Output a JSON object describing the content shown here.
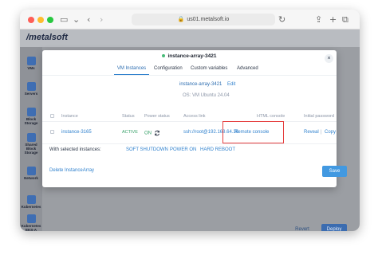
{
  "browser": {
    "url": "us01.metalsoft.io"
  },
  "app": {
    "logo": "/metalsoft",
    "sidebar": [
      "VMs",
      "Servers",
      "Block Storage",
      "Shared Block Storage",
      "Network",
      "Kubernetes",
      "Kubernetes EKS-A"
    ],
    "footer": {
      "revert_label": "Revert",
      "deploy_label": "Deploy"
    }
  },
  "modal": {
    "title": "instance-array-3421",
    "close_label": "×",
    "tabs": [
      "VM Instances",
      "Configuration",
      "Custom variables",
      "Advanced"
    ],
    "active_tab": "VM Instances",
    "array_name": "instance-array-3421",
    "edit_label": "Edit",
    "os_line": "OS: VM Ubuntu 24.04",
    "table": {
      "headers": [
        "Instance",
        "Status",
        "Power status",
        "Access link",
        "HTML console",
        "Initial password"
      ],
      "row": {
        "instance": "instance-3165",
        "status": "ACTIVE",
        "power": "ON",
        "access": "ssh://root@192.168.64.36",
        "console": "Remote console",
        "reveal": "Reveal",
        "separator": "|",
        "copy": "Copy"
      }
    },
    "bulk": {
      "label": "With selected instances:",
      "soft_shutdown": "SOFT SHUTDOWN",
      "power_on": "POWER ON",
      "hard_reboot": "HARD REBOOT"
    },
    "delete_label": "Delete InstanceArray",
    "save_label": "Save"
  },
  "colors": {
    "accent": "#3182ce",
    "status_green": "#48bb78",
    "highlight_red": "#e53e3e"
  }
}
